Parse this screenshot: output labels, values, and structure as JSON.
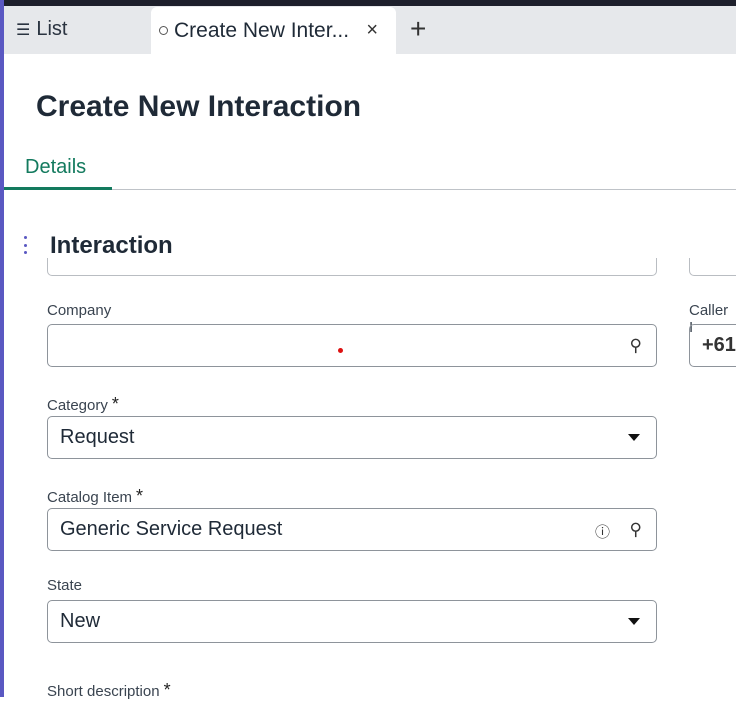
{
  "tabs": {
    "list_label": "List",
    "active_label": "Create New Inter...",
    "close": "×",
    "add": "+"
  },
  "page_title": "Create New Interaction",
  "form_tabs": [
    {
      "label": "Details"
    }
  ],
  "section_title": "Interaction",
  "fields": {
    "company": {
      "label": "Company",
      "value": ""
    },
    "caller": {
      "label": "Caller I",
      "value": "+61"
    },
    "category": {
      "label": "Category",
      "value": "Request",
      "required": "*"
    },
    "catalog_item": {
      "label": "Catalog Item",
      "value": "Generic Service Request",
      "required": "*"
    },
    "state": {
      "label": "State",
      "value": "New"
    },
    "short_description": {
      "label": "Short description",
      "required": "*"
    }
  },
  "colors": {
    "accent": "#137a5e",
    "sidebar": "#5a58c2"
  }
}
